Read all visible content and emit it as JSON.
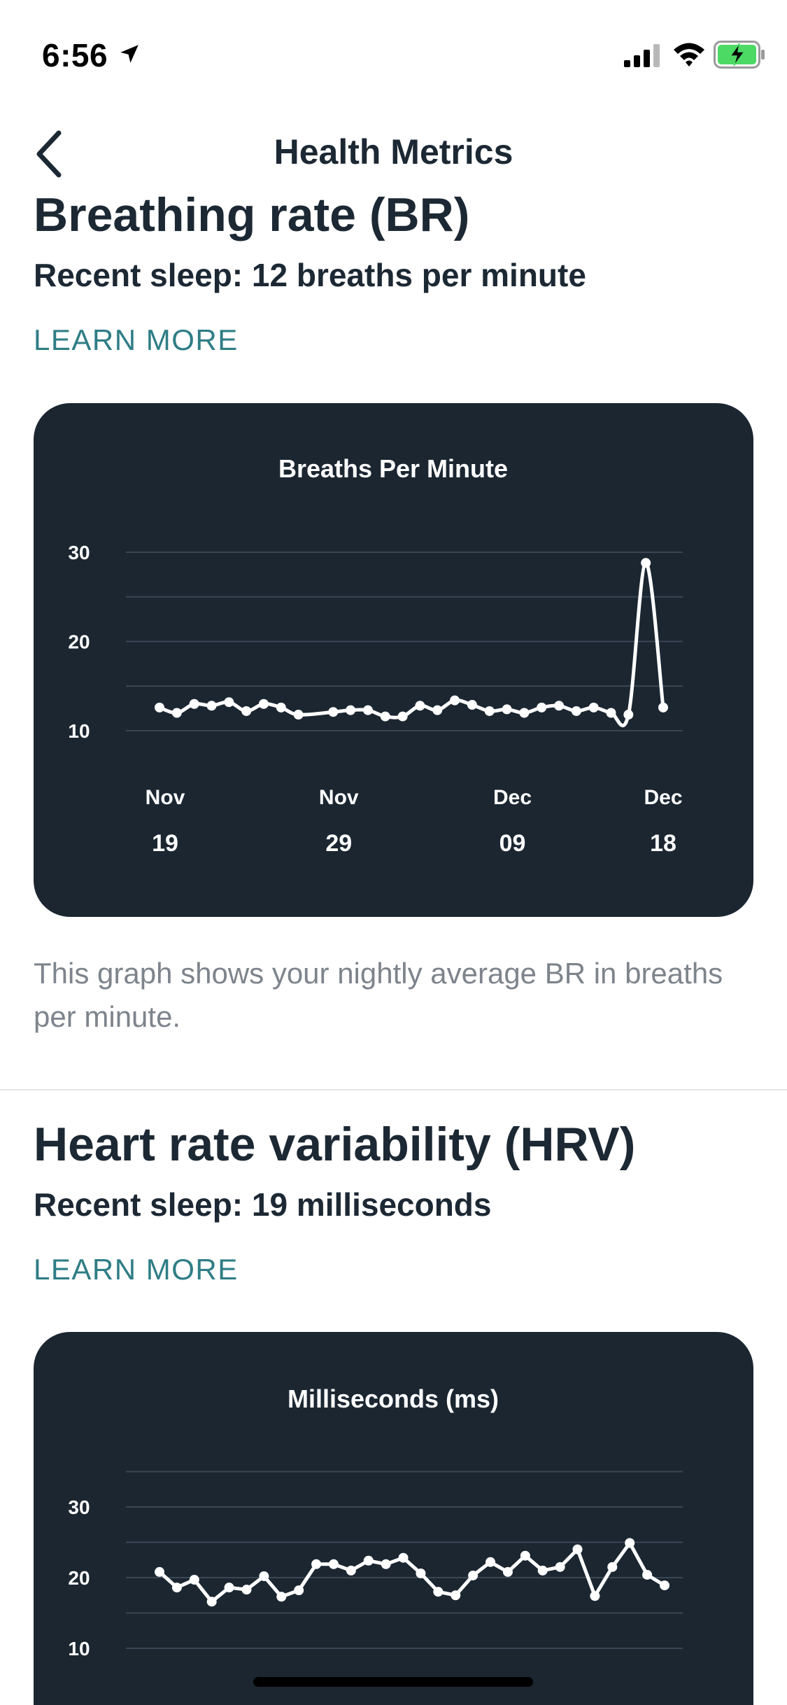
{
  "status_bar": {
    "time": "6:56",
    "icons": [
      "location-arrow-icon",
      "cellular-signal-icon",
      "wifi-icon",
      "battery-charging-icon"
    ],
    "battery_color": "#4cd964"
  },
  "nav": {
    "title": "Health Metrics",
    "back_icon": "chevron-left-icon"
  },
  "colors": {
    "card_bg": "#1b2631",
    "accent_link": "#2f7d86",
    "text_primary": "#1c2833",
    "text_secondary": "#7d848c"
  },
  "br_section": {
    "title": "Breathing rate (BR)",
    "recent": "Recent sleep: 12 breaths per minute",
    "learn_more": "LEARN MORE",
    "description": "This graph shows your nightly average BR in breaths per minute."
  },
  "hrv_section": {
    "title": "Heart rate variability (HRV)",
    "recent": "Recent sleep: 19 milliseconds",
    "learn_more": "LEARN MORE"
  },
  "chart_data": [
    {
      "type": "line",
      "title": "Breaths Per Minute",
      "ylim": [
        10,
        30
      ],
      "yticks": [
        10,
        20,
        30
      ],
      "grid": true,
      "x_tick_labels": [
        {
          "month": "Nov",
          "day": "19"
        },
        {
          "month": "Nov",
          "day": "29"
        },
        {
          "month": "Dec",
          "day": "09"
        },
        {
          "month": "Dec",
          "day": "18"
        }
      ],
      "x_range": [
        0,
        29
      ],
      "x_tick_values": [
        0,
        10,
        20,
        29
      ],
      "series": [
        {
          "values": [
            [
              0,
              12.6
            ],
            [
              1,
              12.0
            ],
            [
              2,
              13.0
            ],
            [
              3,
              12.8
            ],
            [
              4,
              13.2
            ],
            [
              5,
              12.2
            ],
            [
              6,
              13.0
            ],
            [
              7,
              12.6
            ],
            [
              8,
              11.8
            ],
            [
              10,
              12.1
            ],
            [
              11,
              12.3
            ],
            [
              12,
              12.3
            ],
            [
              13,
              11.6
            ],
            [
              14,
              11.6
            ],
            [
              15,
              12.8
            ],
            [
              16,
              12.3
            ],
            [
              17,
              13.4
            ],
            [
              18,
              12.9
            ],
            [
              19,
              12.2
            ],
            [
              20,
              12.4
            ],
            [
              21,
              12.0
            ],
            [
              22,
              12.6
            ],
            [
              23,
              12.8
            ],
            [
              24,
              12.2
            ],
            [
              25,
              12.6
            ],
            [
              26,
              12.0
            ],
            [
              27,
              11.8
            ],
            [
              28,
              28.8
            ],
            [
              29,
              12.6
            ]
          ]
        }
      ]
    },
    {
      "type": "line",
      "title": "Milliseconds (ms)",
      "ylim": [
        10,
        30
      ],
      "yticks": [
        10,
        20,
        30
      ],
      "grid": true,
      "x_range": [
        0,
        29
      ],
      "series": [
        {
          "values": [
            [
              0,
              20.8
            ],
            [
              1,
              18.6
            ],
            [
              2,
              19.7
            ],
            [
              3,
              16.6
            ],
            [
              4,
              18.6
            ],
            [
              5,
              18.3
            ],
            [
              6,
              20.2
            ],
            [
              7,
              17.3
            ],
            [
              8,
              18.2
            ],
            [
              9,
              21.9
            ],
            [
              10,
              21.9
            ],
            [
              11,
              21.0
            ],
            [
              12,
              22.4
            ],
            [
              13,
              21.9
            ],
            [
              14,
              22.8
            ],
            [
              15,
              20.6
            ],
            [
              16,
              18.0
            ],
            [
              17,
              17.5
            ],
            [
              18,
              20.3
            ],
            [
              19,
              22.2
            ],
            [
              20,
              20.8
            ],
            [
              21,
              23.1
            ],
            [
              22,
              21.0
            ],
            [
              23,
              21.5
            ],
            [
              24,
              24.0
            ],
            [
              25,
              17.4
            ],
            [
              26,
              21.5
            ],
            [
              27,
              24.9
            ],
            [
              28,
              20.4
            ],
            [
              29,
              18.9
            ]
          ]
        }
      ]
    }
  ]
}
